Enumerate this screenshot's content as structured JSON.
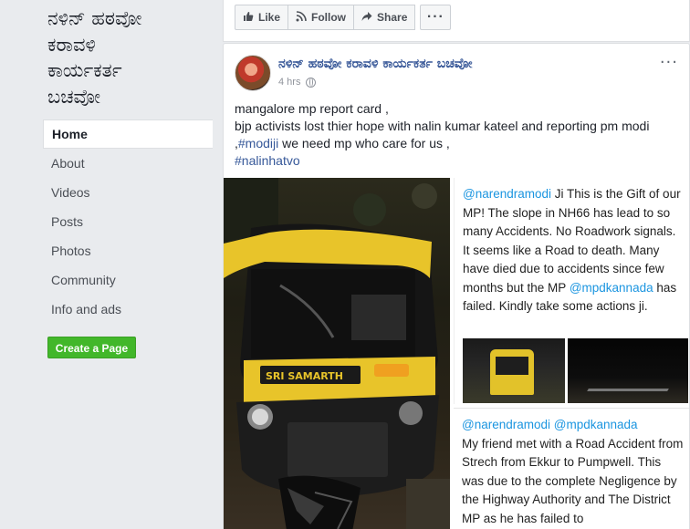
{
  "page": {
    "name_lines": [
      "ನಳಿನ್ ಹಠವೋ",
      "ಕರಾವಳಿ",
      "ಕಾರ್ಯಕರ್ತ",
      "ಬಚವೋ"
    ]
  },
  "sidebar": {
    "items": [
      {
        "label": "Home",
        "active": true
      },
      {
        "label": "About"
      },
      {
        "label": "Videos"
      },
      {
        "label": "Posts"
      },
      {
        "label": "Photos"
      },
      {
        "label": "Community"
      },
      {
        "label": "Info and ads"
      }
    ],
    "create_page_label": "Create a Page"
  },
  "actions": {
    "like_label": "Like",
    "follow_label": "Follow",
    "share_label": "Share",
    "more_label": "···",
    "like_icon": "thumbs-up-icon",
    "follow_icon": "rss-icon",
    "share_icon": "share-arrow-icon"
  },
  "post": {
    "author": "ನಳಿನ್ ಹಠವೋ ಕರಾವಳಿ ಕಾರ್ಯಕರ್ತ ಬಚವೋ",
    "time": "4 hrs",
    "menu_label": "···",
    "text_lines": [
      "mangalore mp report card ,",
      "bjp activists lost thier hope with nalin kumar kateel and reporting pm modi",
      ",",
      "#modiji",
      " we need mp who care for us ,",
      "#nalinhatvo"
    ],
    "image_right_top": {
      "mention1": "@narendramodi",
      "text1": " Ji This is the Gift of our MP! The slope in NH66 has lead to so many Accidents. No Roadwork signals. It seems like a Road to death. Many have died due to accidents since few months but the MP ",
      "mention2": "@mpdkannada",
      "text2": " has failed. Kindly take some actions ji."
    },
    "image_right_bottom": {
      "mention1": "@narendramodi",
      "mention2": "@mpdkannada",
      "text": "My friend met with a Road Accident from Strech from Ekkur to Pumpwell. This was due to the complete Negligence by the Highway Authority and The District MP as he has failed to"
    },
    "image_left": {
      "plate_text": "SRI SAMARTH"
    }
  },
  "colors": {
    "link": "#385898",
    "mention": "#1b95e0",
    "create_button": "#42b72a",
    "background": "#e9ebee"
  }
}
